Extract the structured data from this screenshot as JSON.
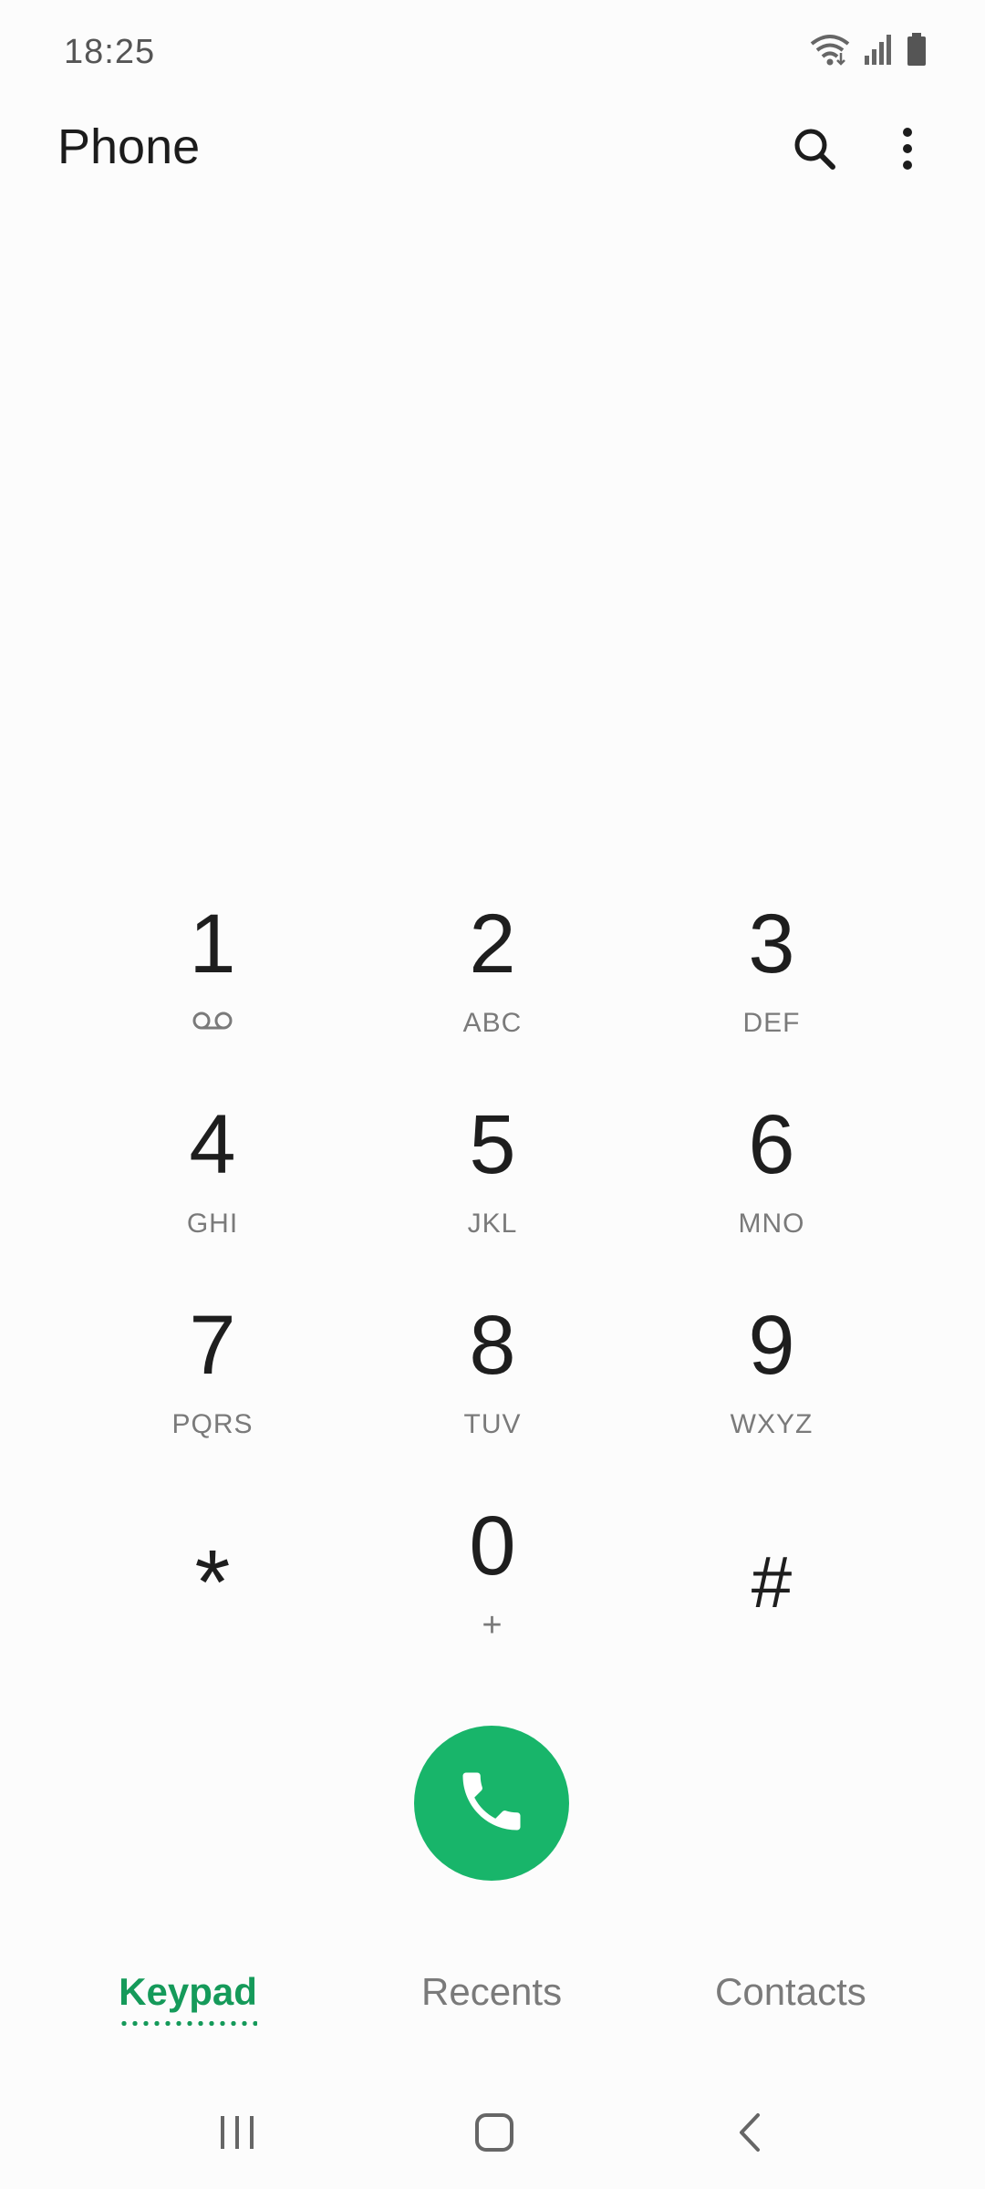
{
  "status_bar": {
    "time": "18:25",
    "icons": [
      "wifi-icon",
      "signal-icon",
      "battery-icon"
    ]
  },
  "app_bar": {
    "title": "Phone",
    "actions": [
      "search-icon",
      "more-options-icon"
    ]
  },
  "keypad": {
    "keys": [
      {
        "digit": "1",
        "letters": "",
        "sub_icon": "voicemail-icon"
      },
      {
        "digit": "2",
        "letters": "ABC"
      },
      {
        "digit": "3",
        "letters": "DEF"
      },
      {
        "digit": "4",
        "letters": "GHI"
      },
      {
        "digit": "5",
        "letters": "JKL"
      },
      {
        "digit": "6",
        "letters": "MNO"
      },
      {
        "digit": "7",
        "letters": "PQRS"
      },
      {
        "digit": "8",
        "letters": "TUV"
      },
      {
        "digit": "9",
        "letters": "WXYZ"
      },
      {
        "digit": "*",
        "letters": ""
      },
      {
        "digit": "0",
        "letters": "+"
      },
      {
        "digit": "#",
        "letters": ""
      }
    ]
  },
  "call_button": {
    "icon": "phone-icon",
    "color": "#18b56a"
  },
  "tabs": [
    {
      "label": "Keypad",
      "active": true
    },
    {
      "label": "Recents",
      "active": false
    },
    {
      "label": "Contacts",
      "active": false
    }
  ],
  "accent_color": "#159a5a",
  "nav_bar": {
    "buttons": [
      "recent-apps-icon",
      "home-icon",
      "back-icon"
    ]
  }
}
